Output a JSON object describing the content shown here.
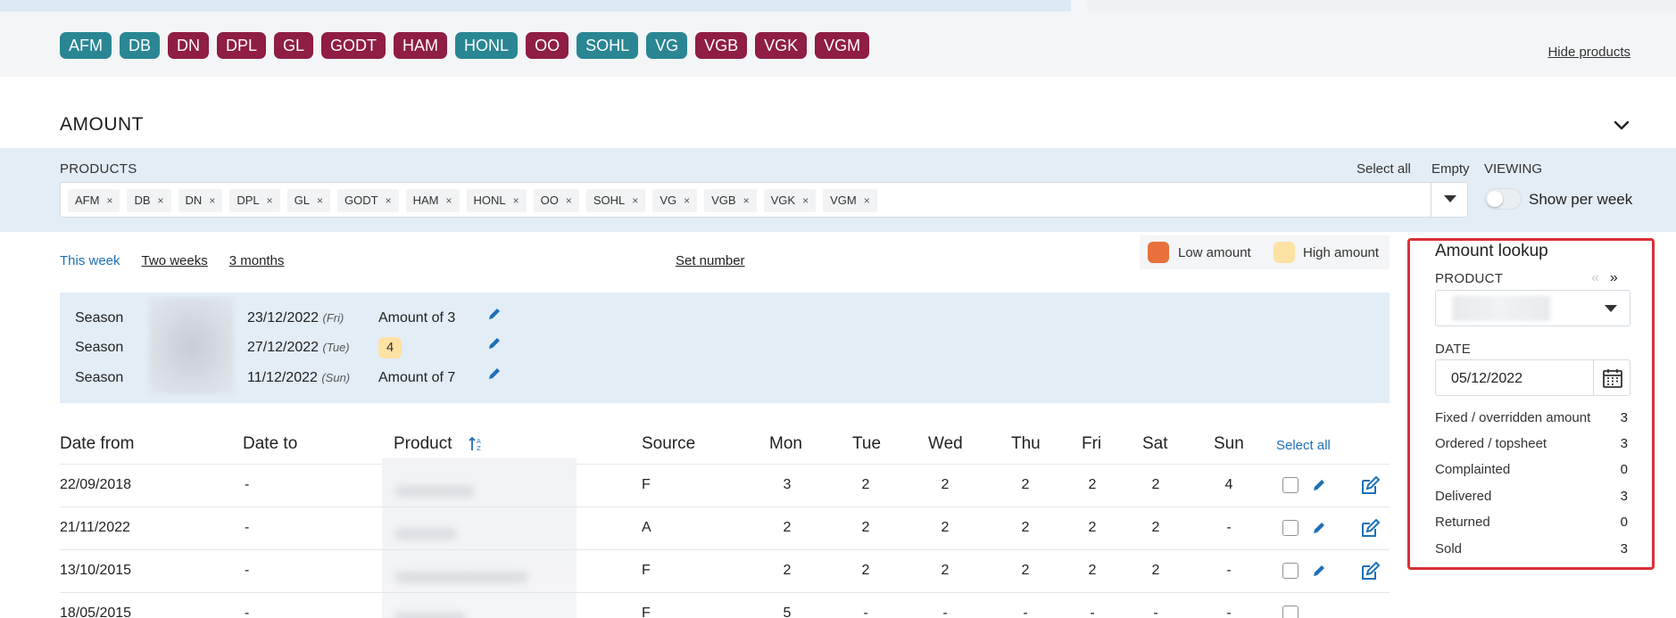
{
  "top": {
    "chips": [
      {
        "label": "AFM",
        "color": "#2a8693"
      },
      {
        "label": "DB",
        "color": "#2a8693"
      },
      {
        "label": "DN",
        "color": "#8f1d44"
      },
      {
        "label": "DPL",
        "color": "#8f1d44"
      },
      {
        "label": "GL",
        "color": "#8f1d44"
      },
      {
        "label": "GODT",
        "color": "#8f1d44"
      },
      {
        "label": "HAM",
        "color": "#8f1d44"
      },
      {
        "label": "HONL",
        "color": "#2a8693"
      },
      {
        "label": "OO",
        "color": "#8f1d44"
      },
      {
        "label": "SOHL",
        "color": "#2a8693"
      },
      {
        "label": "VG",
        "color": "#2a8693"
      },
      {
        "label": "VGB",
        "color": "#8f1d44"
      },
      {
        "label": "VGK",
        "color": "#8f1d44"
      },
      {
        "label": "VGM",
        "color": "#8f1d44"
      }
    ],
    "hide_products": "Hide products"
  },
  "section": {
    "title": "AMOUNT"
  },
  "filters": {
    "products_label": "PRODUCTS",
    "select_all": "Select all",
    "empty": "Empty",
    "viewing_label": "VIEWING",
    "show_per_week": "Show per week",
    "tags": [
      "AFM",
      "DB",
      "DN",
      "DPL",
      "GL",
      "GODT",
      "HAM",
      "HONL",
      "OO",
      "SOHL",
      "VG",
      "VGB",
      "VGK",
      "VGM"
    ],
    "tag_remove": "×"
  },
  "periods": {
    "this_week": "This week",
    "two_weeks": "Two weeks",
    "three_months": "3 months",
    "set_number": "Set number"
  },
  "legend": {
    "low": "Low amount",
    "high": "High amount",
    "low_color": "#e8703a",
    "high_color": "#fde2a3"
  },
  "seasons": [
    {
      "label": "Season",
      "date": "23/12/2022",
      "day": "(Fri)",
      "amount": "Amount of 3"
    },
    {
      "label": "Season",
      "date": "27/12/2022",
      "day": "(Tue)",
      "badge": "4"
    },
    {
      "label": "Season",
      "date": "11/12/2022",
      "day": "(Sun)",
      "amount": "Amount of 7"
    }
  ],
  "table": {
    "headers": {
      "date_from": "Date from",
      "date_to": "Date to",
      "product": "Product",
      "source": "Source",
      "mon": "Mon",
      "tue": "Tue",
      "wed": "Wed",
      "thu": "Thu",
      "fri": "Fri",
      "sat": "Sat",
      "sun": "Sun",
      "select_all": "Select all"
    },
    "rows": [
      {
        "date_from": "22/09/2018",
        "date_to": "-",
        "source": "F",
        "days": [
          "3",
          "2",
          "2",
          "2",
          "2",
          "2",
          "4"
        ]
      },
      {
        "date_from": "21/11/2022",
        "date_to": "-",
        "source": "A",
        "days": [
          "2",
          "2",
          "2",
          "2",
          "2",
          "2",
          "-"
        ]
      },
      {
        "date_from": "13/10/2015",
        "date_to": "-",
        "source": "F",
        "days": [
          "2",
          "2",
          "2",
          "2",
          "2",
          "2",
          "-"
        ]
      },
      {
        "date_from": "18/05/2015",
        "date_to": "-",
        "source": "F",
        "days": [
          "5",
          "-",
          "-",
          "-",
          "-",
          "-",
          "-"
        ]
      }
    ]
  },
  "lookup": {
    "title": "Amount lookup",
    "product_label": "PRODUCT",
    "prev": "«",
    "next": "»",
    "date_label": "DATE",
    "date_value": "05/12/2022",
    "stats": [
      {
        "label": "Fixed / overridden amount",
        "value": "3"
      },
      {
        "label": "Ordered / topsheet",
        "value": "3"
      },
      {
        "label": "Complainted",
        "value": "0"
      },
      {
        "label": "Delivered",
        "value": "3"
      },
      {
        "label": "Returned",
        "value": "0"
      },
      {
        "label": "Sold",
        "value": "3"
      }
    ],
    "highlight_color": "#d9313a"
  },
  "colors": {
    "accent": "#1f6fb6",
    "teal": "#2a8693",
    "maroon": "#8f1d44"
  }
}
